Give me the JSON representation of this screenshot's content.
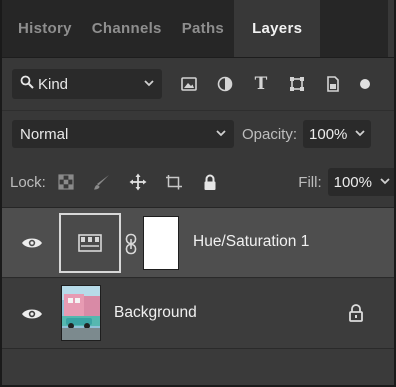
{
  "tabs": [
    {
      "label": "History",
      "active": false
    },
    {
      "label": "Channels",
      "active": false
    },
    {
      "label": "Paths",
      "active": false
    },
    {
      "label": "Layers",
      "active": true
    }
  ],
  "filter": {
    "kind_label": "Kind",
    "icons": [
      "search-icon",
      "image-filter-icon",
      "adjustment-filter-icon",
      "type-filter-icon",
      "shape-filter-icon",
      "smart-object-filter-icon",
      "filter-toggle-icon"
    ],
    "type_glyph": "T"
  },
  "blend": {
    "mode": "Normal",
    "opacity_label": "Opacity:",
    "opacity_value": "100%"
  },
  "lock": {
    "label": "Lock:",
    "icons": [
      "lock-transparent-pixels-icon",
      "lock-image-pixels-icon",
      "lock-position-icon",
      "lock-artboard-icon",
      "lock-all-icon"
    ],
    "fill_label": "Fill:",
    "fill_value": "100%"
  },
  "layers": [
    {
      "name": "Hue/Saturation 1",
      "visible": true,
      "selected": true,
      "type": "adjustment"
    },
    {
      "name": "Background",
      "visible": true,
      "selected": false,
      "type": "image",
      "locked": true
    }
  ],
  "colors": {
    "panel": "#383838",
    "tab_bar": "#262626",
    "selected_layer": "#4e4e4e",
    "text": "#f0f0f0"
  }
}
